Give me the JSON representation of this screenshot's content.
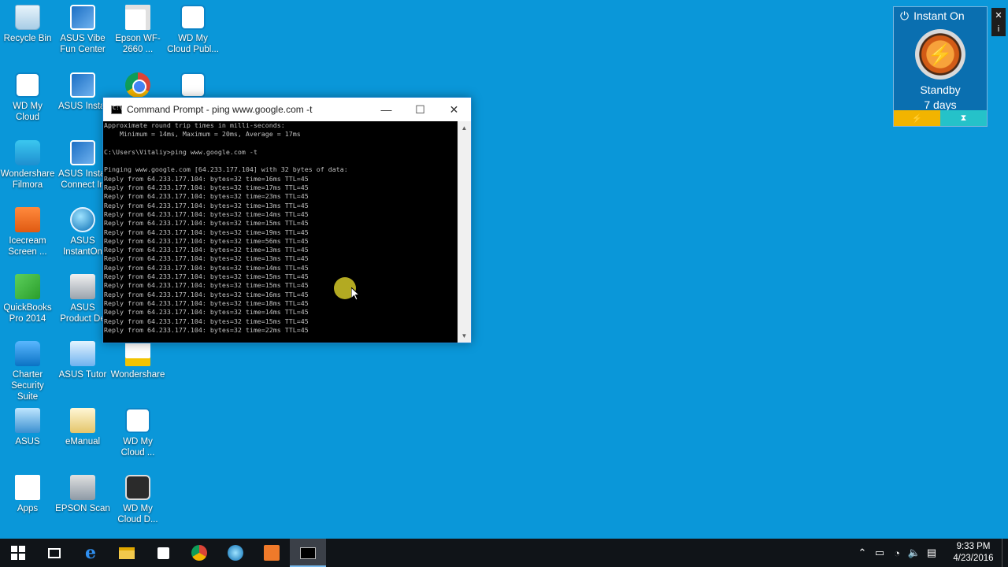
{
  "desktop_icons": [
    {
      "label": "Recycle Bin",
      "icon": "recycle-bin-icon"
    },
    {
      "label": "ASUS  Vibe Fun Center",
      "icon": "asus-vibe-icon"
    },
    {
      "label": "Epson WF-2660 ...",
      "icon": "epson-printer-icon"
    },
    {
      "label": "WD My Cloud Publ...",
      "icon": "wd-cloud-icon"
    },
    {
      "label": "WD My Cloud",
      "icon": "wd-cloud-icon"
    },
    {
      "label": "ASUS Instal",
      "icon": "asus-install-icon"
    },
    {
      "label": "",
      "icon": "chrome-icon"
    },
    {
      "label": "",
      "icon": "cloud-icon"
    },
    {
      "label": "Wondershare Filmora",
      "icon": "filmora-icon"
    },
    {
      "label": "ASUS Instal Connect In",
      "icon": "asus-connect-icon"
    },
    {
      "label": "Icecream Screen ...",
      "icon": "icecream-icon"
    },
    {
      "label": "ASUS InstantOn",
      "icon": "asus-instanton-icon"
    },
    {
      "label": "QuickBooks Pro 2014",
      "icon": "quickbooks-icon"
    },
    {
      "label": "ASUS Product De",
      "icon": "asus-product-icon"
    },
    {
      "label": "Charter Security Suite",
      "icon": "security-lock-icon"
    },
    {
      "label": "ASUS Tutor",
      "icon": "asus-tutor-icon"
    },
    {
      "label": "Wondershare",
      "icon": "wondershare-icon"
    },
    {
      "label": "ASUS",
      "icon": "asus-screen-icon"
    },
    {
      "label": "eManual",
      "icon": "emanual-icon"
    },
    {
      "label": "WD My Cloud ...",
      "icon": "wd-bulb-icon"
    },
    {
      "label": "Apps",
      "icon": "apps-icon"
    },
    {
      "label": "EPSON Scan",
      "icon": "epson-scan-icon"
    },
    {
      "label": "WD My Cloud D...",
      "icon": "wd-desktop-icon"
    }
  ],
  "cmd": {
    "title": "Command Prompt - ping  www.google.com -t",
    "minimize": "—",
    "maximize": "☐",
    "close": "✕",
    "lines": [
      "Approximate round trip times in milli-seconds:",
      "    Minimum = 14ms, Maximum = 20ms, Average = 17ms",
      "",
      "C:\\Users\\Vitaliy>ping www.google.com -t",
      "",
      "Pinging www.google.com [64.233.177.104] with 32 bytes of data:",
      "Reply from 64.233.177.104: bytes=32 time=16ms TTL=45",
      "Reply from 64.233.177.104: bytes=32 time=17ms TTL=45",
      "Reply from 64.233.177.104: bytes=32 time=23ms TTL=45",
      "Reply from 64.233.177.104: bytes=32 time=13ms TTL=45",
      "Reply from 64.233.177.104: bytes=32 time=14ms TTL=45",
      "Reply from 64.233.177.104: bytes=32 time=15ms TTL=45",
      "Reply from 64.233.177.104: bytes=32 time=19ms TTL=45",
      "Reply from 64.233.177.104: bytes=32 time=56ms TTL=45",
      "Reply from 64.233.177.104: bytes=32 time=13ms TTL=45",
      "Reply from 64.233.177.104: bytes=32 time=13ms TTL=45",
      "Reply from 64.233.177.104: bytes=32 time=14ms TTL=45",
      "Reply from 64.233.177.104: bytes=32 time=15ms TTL=45",
      "Reply from 64.233.177.104: bytes=32 time=15ms TTL=45",
      "Reply from 64.233.177.104: bytes=32 time=16ms TTL=45",
      "Reply from 64.233.177.104: bytes=32 time=18ms TTL=45",
      "Reply from 64.233.177.104: bytes=32 time=14ms TTL=45",
      "Reply from 64.233.177.104: bytes=32 time=15ms TTL=45",
      "Reply from 64.233.177.104: bytes=32 time=22ms TTL=45"
    ]
  },
  "instant_on": {
    "title": "Instant On",
    "status": "Standby",
    "duration": "7 days",
    "close": "✕",
    "info": "i"
  },
  "taskbar": {
    "items": [
      "start-icon",
      "task-view-icon",
      "edge-icon",
      "file-explorer-icon",
      "store-icon",
      "chrome-icon",
      "instanton-icon",
      "icecream-icon",
      "command-prompt-icon"
    ],
    "time": "9:33 PM",
    "date": "4/23/2016"
  },
  "colors": {
    "desktop": "#0a97d9",
    "taskbar": "#101418",
    "accent": "#76b9ed"
  }
}
